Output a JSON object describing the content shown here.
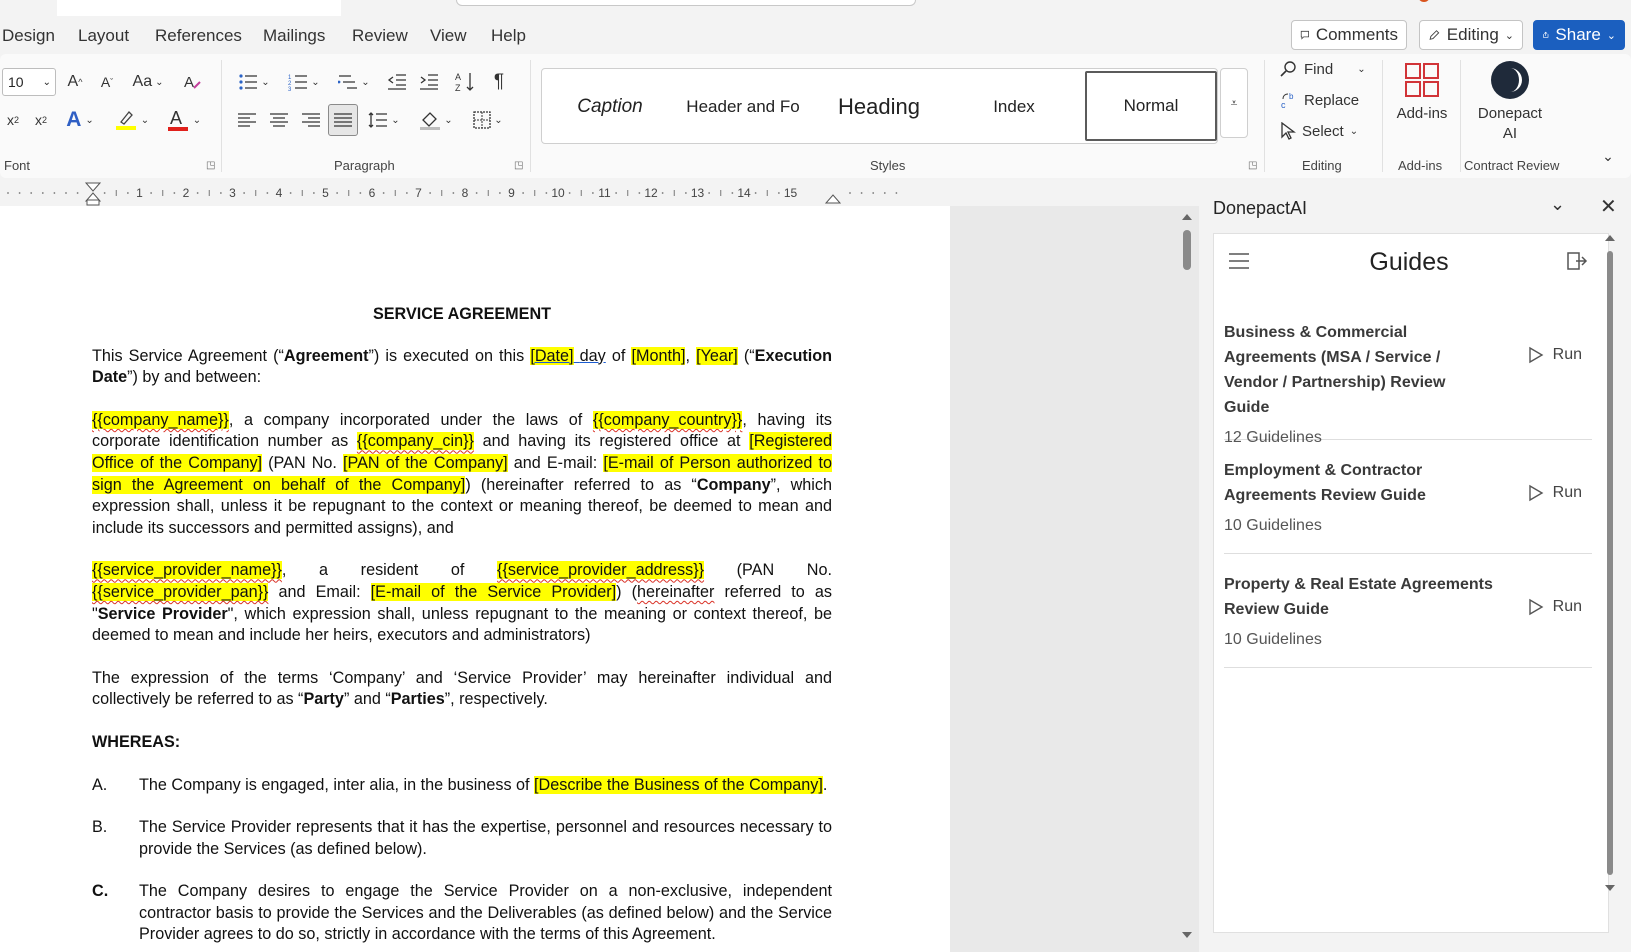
{
  "menu": {
    "tabs": [
      "Design",
      "Layout",
      "References",
      "Mailings",
      "Review",
      "View",
      "Help"
    ],
    "comments_label": "Comments",
    "editing_label": "Editing",
    "share_label": "Share"
  },
  "ribbon": {
    "font": {
      "size_value": "10",
      "group_label": "Font"
    },
    "paragraph": {
      "group_label": "Paragraph"
    },
    "styles": {
      "items": [
        "Caption",
        "Header and Fo",
        "Heading",
        "Index",
        "Normal"
      ],
      "selected": "Normal",
      "group_label": "Styles"
    },
    "editing": {
      "find_label": "Find",
      "replace_label": "Replace",
      "select_label": "Select",
      "group_label": "Editing"
    },
    "addins": {
      "button_label": "Add-ins",
      "group_label": "Add-ins"
    },
    "contract_review": {
      "button_label_line1": "Donepact",
      "button_label_line2": "AI",
      "group_label": "Contract Review"
    }
  },
  "ruler": {
    "numbers": [
      "1",
      "2",
      "3",
      "4",
      "5",
      "6",
      "7",
      "8",
      "9",
      "10",
      "11",
      "12",
      "13",
      "14",
      "15"
    ]
  },
  "document": {
    "title": "SERVICE AGREEMENT",
    "p1": {
      "t1": "This Service Agreement (“",
      "b1": "Agreement",
      "t2": "”) is executed on this ",
      "date": "[Date]",
      "t3": " ",
      "day": "day",
      "t4": " of ",
      "month": "[Month]",
      "t5": ", ",
      "year": "[Year]",
      "t6": " (“",
      "b2": "Execution Date",
      "t7": "”) by and between:"
    },
    "p2": {
      "company_name": "{{company_name}}",
      "t1": ", a company incorporated under the laws of ",
      "company_country": "{{company_country}}",
      "t2": ", having its corporate identification number as ",
      "company_cin": "{{company_cin}}",
      "t3": " and having its registered office at ",
      "reg_office": "[Registered Office of the Company]",
      "t4": " (PAN No. ",
      "pan": "[PAN of the Company]",
      "t5": " and E-mail: ",
      "email": "[E-mail of Person authorized to sign the Agreement on behalf of the Company]",
      "t6": ") (hereinafter referred to as “",
      "b1": "Company",
      "t7": "”, which expression shall, unless it be repugnant to the context or meaning thereof, be deemed to mean and include its successors and permitted assigns), and"
    },
    "p3": {
      "sp_name": "{{service_provider_name}}",
      "t1": ", a resident of ",
      "sp_address": "{{service_provider_address}}",
      "t2": " (PAN No. ",
      "sp_pan": "{{service_provider_pan}}",
      "t3": " and Email: ",
      "sp_email": "[E-mail of the Service Provider]",
      "t4": ") (",
      "hereinafter": "hereinafter",
      "t5": " referred to as \"",
      "b1": "Service Provider",
      "t6": "\", which expression shall, unless repugnant to the meaning or context thereof, be deemed to mean and include her heirs, executors and administrators)"
    },
    "p4": {
      "t1": "The expression of the terms ‘Company’ and ‘Service Provider’ may hereinafter individual and collectively be referred to as “",
      "b1": "Party",
      "t2": "” and “",
      "b2": "Parties",
      "t3": "”, respectively."
    },
    "whereas": "WHEREAS:",
    "items": [
      {
        "marker": "A.",
        "t1": "The Company is engaged, inter alia, in the business of ",
        "hl": "[Describe the Business of the Company]",
        "t2": "."
      },
      {
        "marker": "B.",
        "t1": "The Service Provider represents that it has the expertise, personnel and resources necessary to provide the Services (as defined below)."
      },
      {
        "marker": "C.",
        "t1": "The Company desires to engage the Service Provider on a non-exclusive, independent contractor basis to provide the Services and the Deliverables (as defined below) and the Service Provider agrees to do so, strictly in accordance with the terms of this Agreement."
      }
    ]
  },
  "pane": {
    "title": "DonepactAI",
    "heading": "Guides",
    "run_label": "Run",
    "guides": [
      {
        "name": "Business & Commercial Agreements (MSA / Service / Vendor / Partnership) Review Guide",
        "count": "12 Guidelines"
      },
      {
        "name": "Employment & Contractor Agreements Review Guide",
        "count": "10 Guidelines"
      },
      {
        "name": "Property & Real Estate Agreements Review Guide",
        "count": "10 Guidelines"
      }
    ]
  },
  "colors": {
    "accent": "#1b5fbf",
    "highlight": "#ffff00",
    "addins_red": "#d13438"
  }
}
